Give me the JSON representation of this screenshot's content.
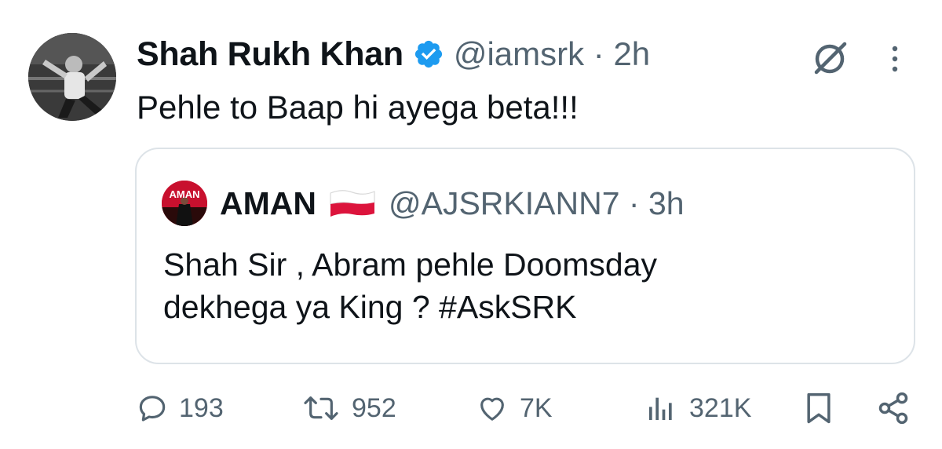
{
  "tweet": {
    "author_name": "Shah Rukh Khan",
    "handle_time": "@iamsrk · 2h",
    "text": "Pehle to Baap hi ayega beta!!!",
    "icons": {
      "verified": "verified-badge-icon",
      "grok": "grok-icon",
      "more": "more-options-icon"
    }
  },
  "quote": {
    "author_name": "AMAN",
    "avatar_text": "AMAN",
    "flag": "poland-flag",
    "handle_time": "@AJSRKIANN7 · 3h",
    "text": "Shah Sir , Abram pehle Doomsday\ndekhega ya King ? #AskSRK"
  },
  "actions": {
    "replies": "193",
    "reposts": "952",
    "likes": "7K",
    "views": "321K",
    "icons": [
      "reply-icon",
      "repost-icon",
      "like-icon",
      "views-icon",
      "bookmark-icon",
      "share-icon"
    ]
  },
  "colors": {
    "verified_blue": "#1d9bf0",
    "muted_gray": "#536471",
    "border": "#dde3e8",
    "text": "#0f1419"
  }
}
